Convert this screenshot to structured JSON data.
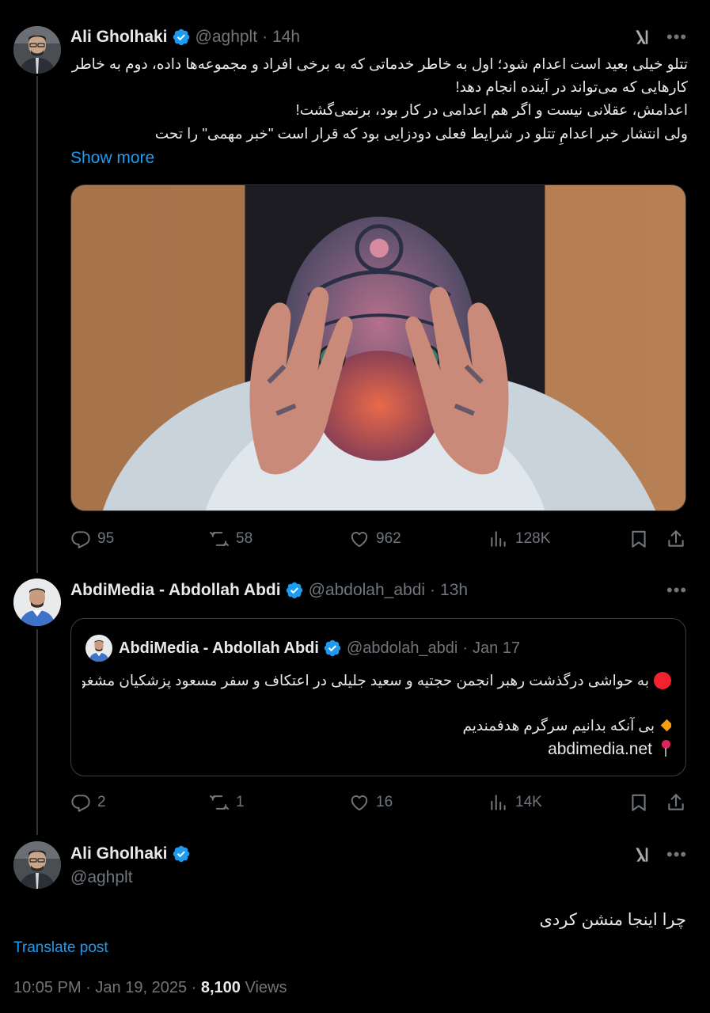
{
  "tweet1": {
    "name": "Ali Gholhaki",
    "handle": "@aghplt",
    "time": "14h",
    "lines": [
      "تتلو خیلی بعید است اعدام شود؛ اول به خاطر خدماتی که به برخی افراد و مجموعه‌ها داده، دوم به خاطر",
      "کارهایی که می‌تواند در آینده انجام دهد!",
      "اعدامش، عقلانی نیست و اگر هم اعدامی در کار بود، برنمی‌گشت!",
      "ولی انتشار خبر اعدامِ تتلو در شرایط فعلی دودزایی بود که قرار است \"خبر مهمی\" را تحت"
    ],
    "show_more": "Show more",
    "image_alt": "tattooed man praying with raised hands",
    "stats": {
      "replies": "95",
      "reposts": "58",
      "likes": "962",
      "views": "128K"
    }
  },
  "tweet2": {
    "name": "AbdiMedia - Abdollah Abdi",
    "handle": "@abdolah_abdi",
    "time": "13h",
    "quote": {
      "name": "AbdiMedia - Abdollah Abdi",
      "handle": "@abdolah_abdi",
      "date": "Jan 17",
      "line1": "به حواشی درگذشت رهبر انجمن حجتیه و سعید جلیلی در اعتکاف و سفر مسعود پزشکیان مشغولیم",
      "line2": "بی آنکه بدانیم سرگرم هدفمندیم",
      "link": "abdimedia.net"
    },
    "stats": {
      "replies": "2",
      "reposts": "1",
      "likes": "16",
      "views": "14K"
    }
  },
  "tweet3": {
    "name": "Ali Gholhaki",
    "handle": "@aghplt",
    "text": "چرا اینجا منشن کردی",
    "translate": "Translate post",
    "time": "10:05 PM",
    "date": "Jan 19, 2025",
    "views_count": "8,100",
    "views_label": "Views"
  },
  "separator": "·",
  "colors": {
    "background": "#000000",
    "text": "#e7e9ea",
    "muted": "#71767b",
    "accent": "#1d9bf0",
    "red_dot": "#f4212e",
    "orange_diamond": "#f59e0b"
  }
}
